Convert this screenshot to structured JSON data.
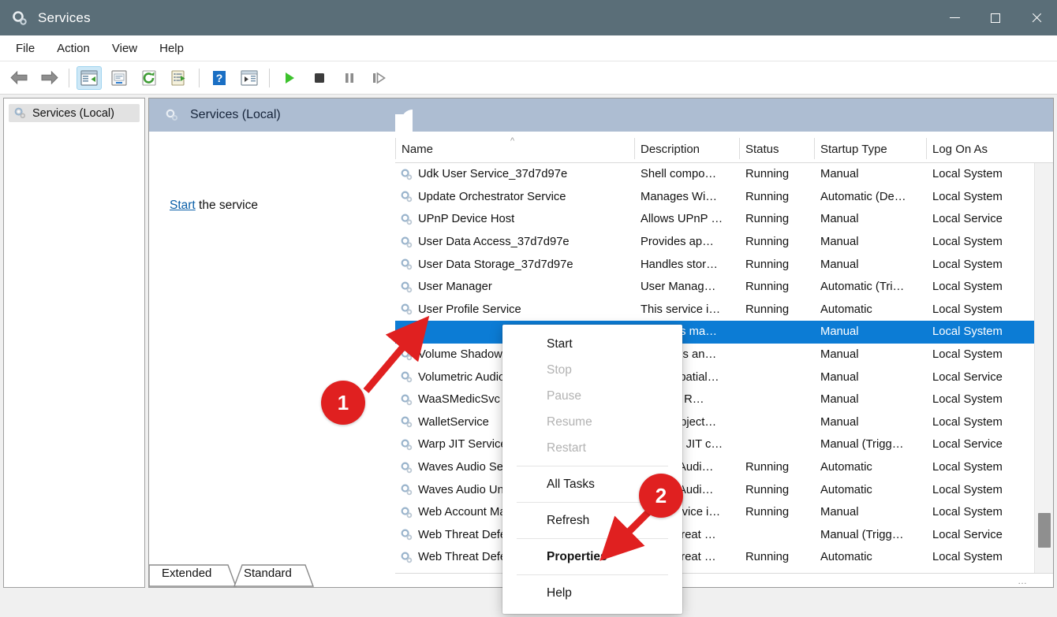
{
  "window": {
    "title": "Services",
    "icon": "services-gear-icon",
    "controls": {
      "minimize": "minimize",
      "maximize": "maximize",
      "close": "close"
    },
    "titlebar_color": "#5a6e78"
  },
  "menubar": {
    "items": [
      "File",
      "Action",
      "View",
      "Help"
    ]
  },
  "toolbar": {
    "buttons": [
      {
        "name": "back-button",
        "icon": "back-arrow-icon"
      },
      {
        "name": "forward-button",
        "icon": "forward-arrow-icon"
      },
      {
        "name": "show-hide-console-tree-button",
        "icon": "console-tree-icon",
        "active": true
      },
      {
        "name": "properties-button",
        "icon": "properties-window-icon"
      },
      {
        "name": "refresh-button",
        "icon": "refresh-icon"
      },
      {
        "name": "export-list-button",
        "icon": "export-list-icon"
      },
      {
        "name": "help-button",
        "icon": "help-question-icon"
      },
      {
        "name": "show-action-pane-button",
        "icon": "action-pane-icon"
      },
      {
        "name": "start-service-button",
        "icon": "play-icon"
      },
      {
        "name": "stop-service-button",
        "icon": "stop-icon"
      },
      {
        "name": "pause-service-button",
        "icon": "pause-icon"
      },
      {
        "name": "restart-service-button",
        "icon": "restart-icon"
      }
    ]
  },
  "tree": {
    "root_label": "Services (Local)",
    "icon": "services-gear-icon"
  },
  "detail_header": {
    "title": "Services (Local)",
    "icon": "services-gear-icon"
  },
  "action_pane": {
    "link_text": "Start",
    "rest_text": " the service"
  },
  "list": {
    "columns": [
      {
        "label": "Name",
        "sorted": "asc",
        "sort_glyph": "^"
      },
      {
        "label": "Description"
      },
      {
        "label": "Status"
      },
      {
        "label": "Startup Type"
      },
      {
        "label": "Log On As"
      }
    ],
    "rows": [
      {
        "name": "Udk User Service_37d7d97e",
        "description": "Shell compo…",
        "status": "Running",
        "startup": "Manual",
        "logon": "Local System",
        "selected": false
      },
      {
        "name": "Update Orchestrator Service",
        "description": "Manages Wi…",
        "status": "Running",
        "startup": "Automatic (De…",
        "logon": "Local System",
        "selected": false
      },
      {
        "name": "UPnP Device Host",
        "description": "Allows UPnP …",
        "status": "Running",
        "startup": "Manual",
        "logon": "Local Service",
        "selected": false
      },
      {
        "name": "User Data Access_37d7d97e",
        "description": "Provides ap…",
        "status": "Running",
        "startup": "Manual",
        "logon": "Local System",
        "selected": false
      },
      {
        "name": "User Data Storage_37d7d97e",
        "description": "Handles stor…",
        "status": "Running",
        "startup": "Manual",
        "logon": "Local System",
        "selected": false
      },
      {
        "name": "User Manager",
        "description": "User Manag…",
        "status": "Running",
        "startup": "Automatic (Tri…",
        "logon": "Local System",
        "selected": false
      },
      {
        "name": "User Profile Service",
        "description": "This service i…",
        "status": "Running",
        "startup": "Automatic",
        "logon": "Local System",
        "selected": false
      },
      {
        "name": "",
        "description": "Provides ma…",
        "status": "",
        "startup": "Manual",
        "logon": "Local System",
        "selected": true
      },
      {
        "name": "Volume Shadow Copy",
        "description": "Manages an…",
        "status": "",
        "startup": "Manual",
        "logon": "Local System",
        "selected": false
      },
      {
        "name": "Volumetric Audio Compositor",
        "description": "Hosts spatial…",
        "status": "",
        "startup": "Manual",
        "logon": "Local Service",
        "selected": false
      },
      {
        "name": "WaaSMedicSvc",
        "description": "Used to R…",
        "status": "",
        "startup": "Manual",
        "logon": "Local System",
        "selected": false
      },
      {
        "name": "WalletService",
        "description": "Hosts object…",
        "status": "",
        "startup": "Manual",
        "logon": "Local System",
        "selected": false
      },
      {
        "name": "Warp JIT Service",
        "description": "Enables JIT c…",
        "status": "",
        "startup": "Manual (Trigg…",
        "logon": "Local Service",
        "selected": false
      },
      {
        "name": "Waves Audio Service",
        "description": "Waves Audi…",
        "status": "Running",
        "startup": "Automatic",
        "logon": "Local System",
        "selected": false
      },
      {
        "name": "Waves Audio Universal Service",
        "description": "Waves Audi…",
        "status": "Running",
        "startup": "Automatic",
        "logon": "Local System",
        "selected": false
      },
      {
        "name": "Web Account Manager",
        "description": "This service i…",
        "status": "Running",
        "startup": "Manual",
        "logon": "Local System",
        "selected": false
      },
      {
        "name": "Web Threat Defense Service",
        "description": "Web Threat …",
        "status": "",
        "startup": "Manual (Trigg…",
        "logon": "Local Service",
        "selected": false
      },
      {
        "name": "Web Threat Defense User Service",
        "description": "Web Threat …",
        "status": "Running",
        "startup": "Automatic",
        "logon": "Local System",
        "selected": false
      }
    ],
    "selected_row_color": "#0c7cd5"
  },
  "context_menu": {
    "items": [
      {
        "label": "Start",
        "enabled": true,
        "bold": false
      },
      {
        "label": "Stop",
        "enabled": false,
        "bold": false
      },
      {
        "label": "Pause",
        "enabled": false,
        "bold": false
      },
      {
        "label": "Resume",
        "enabled": false,
        "bold": false
      },
      {
        "label": "Restart",
        "enabled": false,
        "bold": false
      },
      {
        "separator": true
      },
      {
        "label": "All Tasks",
        "enabled": true,
        "bold": false
      },
      {
        "separator": true
      },
      {
        "label": "Refresh",
        "enabled": true,
        "bold": false
      },
      {
        "separator": true
      },
      {
        "label": "Properties",
        "enabled": true,
        "bold": true
      },
      {
        "separator": true
      },
      {
        "label": "Help",
        "enabled": true,
        "bold": false
      }
    ]
  },
  "tabs": {
    "items": [
      "Extended",
      "Standard"
    ],
    "active": "Extended"
  },
  "annotations": {
    "color": "#e02020",
    "markers": [
      {
        "number": "1",
        "target": "selected-service-row"
      },
      {
        "number": "2",
        "target": "properties-menu-item"
      }
    ]
  }
}
